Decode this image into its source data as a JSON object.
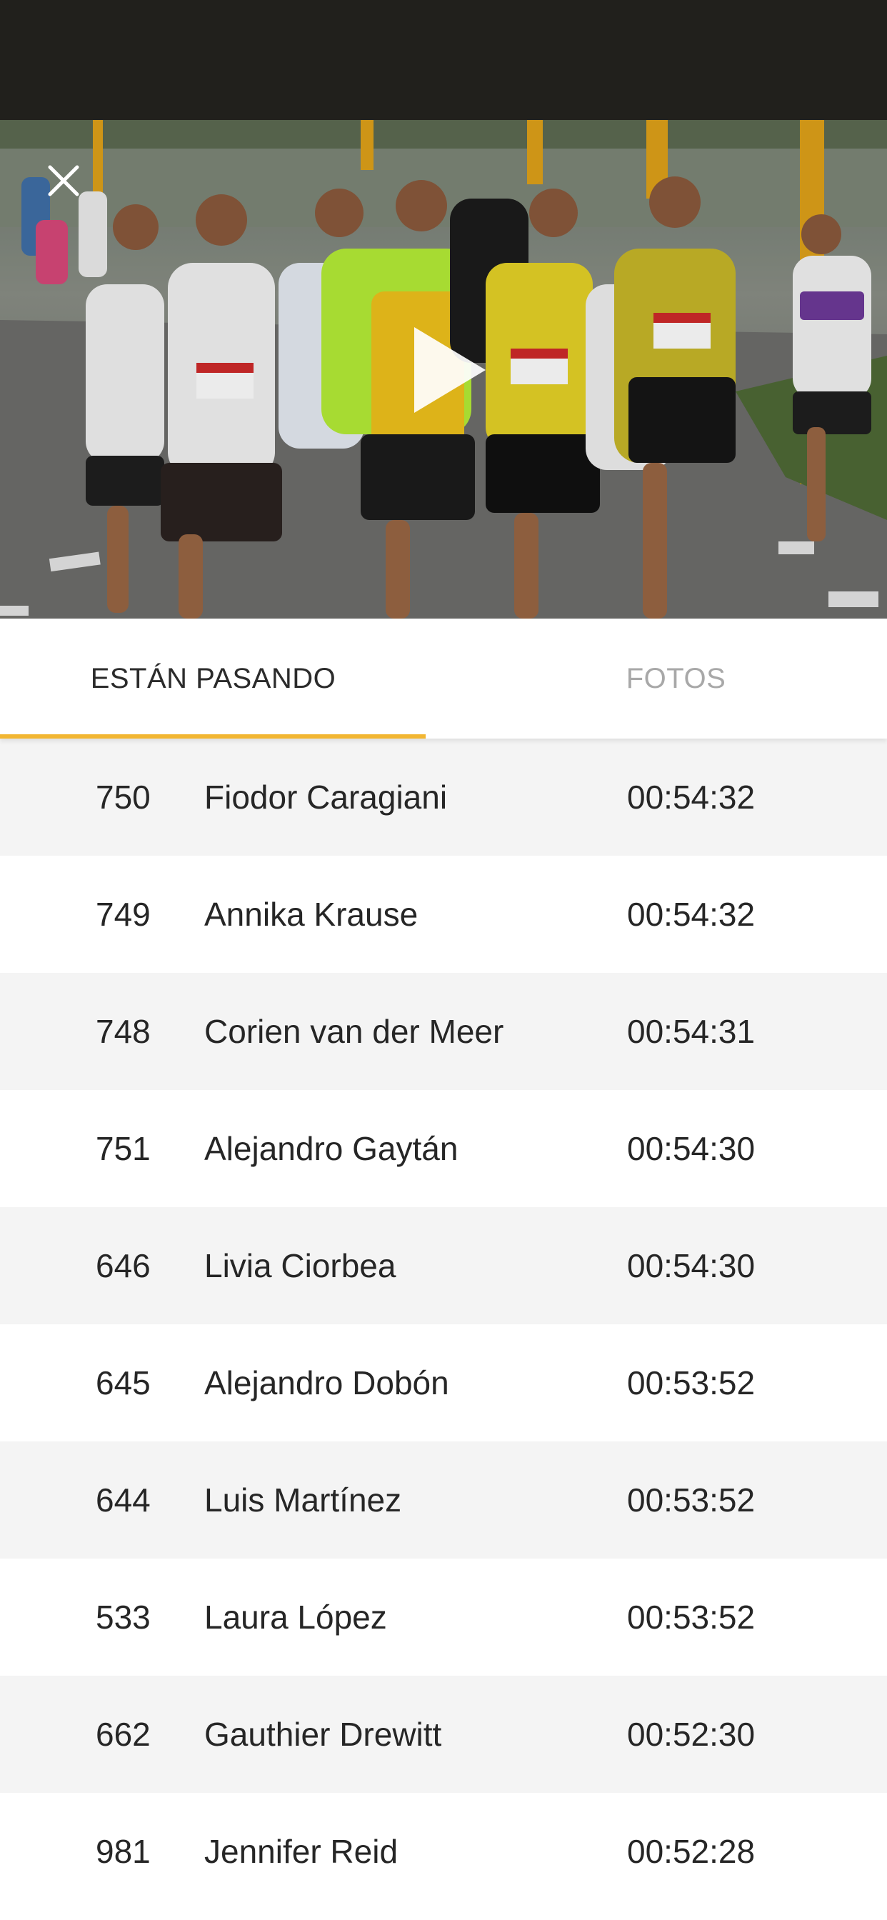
{
  "video": {
    "close_icon": "close-icon",
    "play_icon": "play-icon"
  },
  "tabs": [
    {
      "label": "ESTÁN PASANDO",
      "active": true
    },
    {
      "label": "FOTOS",
      "active": false
    }
  ],
  "colors": {
    "accent": "#f2b632",
    "top_bar": "#21201c",
    "row_alt": "#f4f4f4"
  },
  "runners": [
    {
      "bib": "750",
      "name": "Fiodor Caragiani",
      "time": "00:54:32"
    },
    {
      "bib": "749",
      "name": "Annika Krause",
      "time": "00:54:32"
    },
    {
      "bib": "748",
      "name": "Corien van der Meer",
      "time": "00:54:31"
    },
    {
      "bib": "751",
      "name": "Alejandro Gaytán",
      "time": "00:54:30"
    },
    {
      "bib": "646",
      "name": "Livia Ciorbea",
      "time": "00:54:30"
    },
    {
      "bib": "645",
      "name": "Alejandro Dobón",
      "time": "00:53:52"
    },
    {
      "bib": "644",
      "name": "Luis Martínez",
      "time": "00:53:52"
    },
    {
      "bib": "533",
      "name": "Laura López",
      "time": "00:53:52"
    },
    {
      "bib": "662",
      "name": "Gauthier Drewitt",
      "time": "00:52:30"
    },
    {
      "bib": "981",
      "name": "Jennifer Reid",
      "time": "00:52:28"
    }
  ]
}
